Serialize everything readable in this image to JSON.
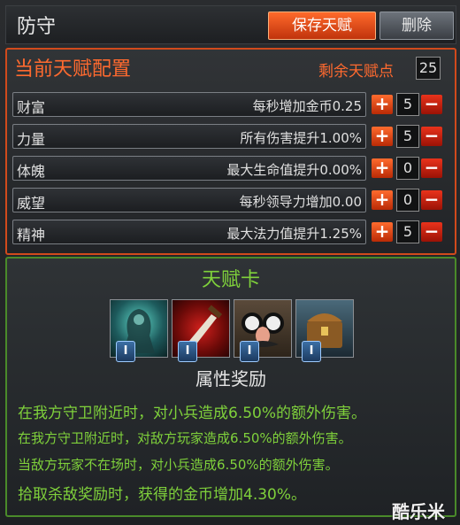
{
  "header": {
    "title": "防守",
    "save_label": "保存天赋",
    "delete_label": "删除"
  },
  "config": {
    "title": "当前天赋配置",
    "remaining_label": "剩余天赋点",
    "remaining_value": "25",
    "rows": [
      {
        "name": "财富",
        "effect": "每秒增加金币0.25",
        "value": "5",
        "plus": "+",
        "minus": "−"
      },
      {
        "name": "力量",
        "effect": "所有伤害提升1.00%",
        "value": "5",
        "plus": "+",
        "minus": "−"
      },
      {
        "name": "体魄",
        "effect": "最大生命值提升0.00%",
        "value": "0",
        "plus": "+",
        "minus": "−"
      },
      {
        "name": "威望",
        "effect": "每秒领导力增加0.00",
        "value": "0",
        "plus": "+",
        "minus": "−"
      },
      {
        "name": "精神",
        "effect": "最大法力值提升1.25%",
        "value": "5",
        "plus": "+",
        "minus": "−"
      }
    ]
  },
  "cards": {
    "title": "天赋卡",
    "items": [
      {
        "icon": "ghost-warrior-card-icon",
        "level": "I"
      },
      {
        "icon": "dagger-card-icon",
        "level": "I"
      },
      {
        "icon": "disguise-glasses-card-icon",
        "level": "I"
      },
      {
        "icon": "treasure-chest-card-icon",
        "level": "I"
      }
    ],
    "bonus_title": "属性奖励",
    "bonuses": [
      "在我方守卫附近时，对小兵造成6.50%的额外伤害。",
      "在我方守卫附近时，对敌方玩家造成6.50%的额外伤害。",
      "当敌方玩家不在场时，对小兵造成6.50%的额外伤害。",
      "拾取杀敌奖励时，获得的金币增加4.30%。"
    ]
  },
  "watermark": "酷乐米",
  "colors": {
    "accent_orange": "#ff6a2f",
    "accent_green": "#7fd13b",
    "border_red": "#d14a1c"
  }
}
